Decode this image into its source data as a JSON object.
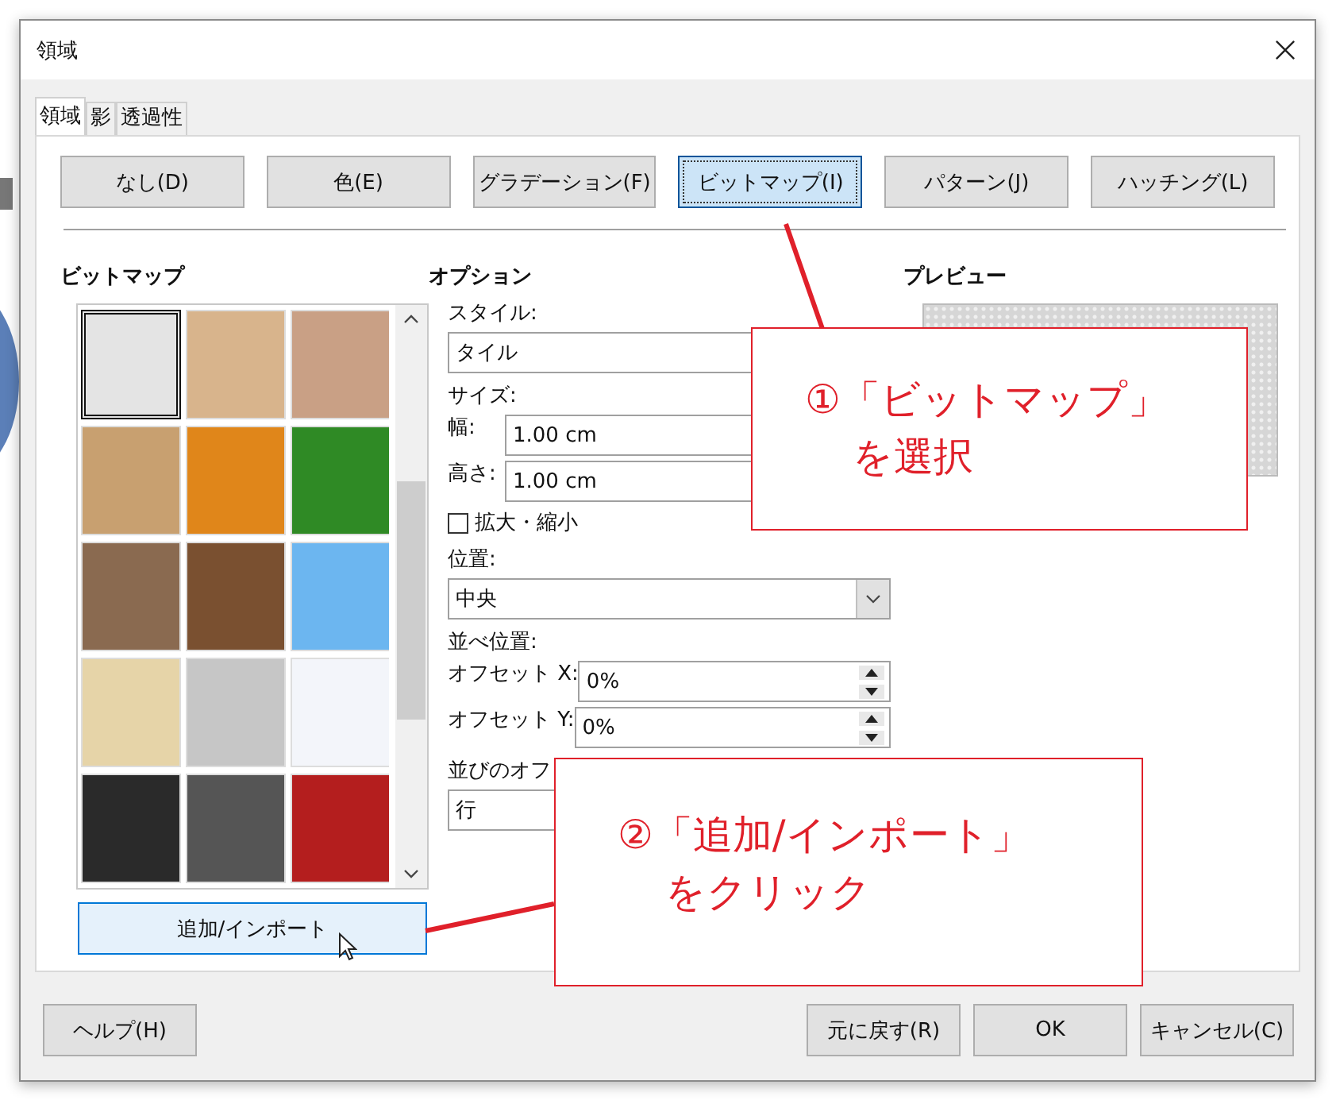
{
  "window": {
    "title": "領域"
  },
  "tabs": [
    {
      "label": "領域",
      "selected": true
    },
    {
      "label": "影",
      "selected": false
    },
    {
      "label": "透過性",
      "selected": false
    }
  ],
  "fill_buttons": [
    {
      "label": "なし(D)",
      "selected": false
    },
    {
      "label": "色(E)",
      "selected": false
    },
    {
      "label": "グラデーション(F)",
      "selected": false
    },
    {
      "label": "ビットマップ(I)",
      "selected": true
    },
    {
      "label": "パターン(J)",
      "selected": false
    },
    {
      "label": "ハッチング(L)",
      "selected": false
    }
  ],
  "bitmap_panel": {
    "heading": "ビットマップ",
    "swatches": [
      {
        "color": "#e4e4e4",
        "selected": true
      },
      {
        "color": "#d8b48c",
        "selected": false
      },
      {
        "color": "#c9a085",
        "selected": false
      },
      {
        "color": "#c8a070",
        "selected": false
      },
      {
        "color": "#e0861a",
        "selected": false
      },
      {
        "color": "#2f8a25",
        "selected": false
      },
      {
        "color": "#8a6a50",
        "selected": false
      },
      {
        "color": "#7a5030",
        "selected": false
      },
      {
        "color": "#6cb6f0",
        "selected": false
      },
      {
        "color": "#e6d4a8",
        "selected": false
      },
      {
        "color": "#c6c6c6",
        "selected": false
      },
      {
        "color": "#f3f5fa",
        "selected": false
      },
      {
        "color": "#2a2a2a",
        "selected": false
      },
      {
        "color": "#555555",
        "selected": false
      },
      {
        "color": "#b41e1e",
        "selected": false
      }
    ],
    "add_button": "追加/インポート"
  },
  "options": {
    "heading": "オプション",
    "style_label": "スタイル:",
    "style_value": "タイル",
    "size_label": "サイズ:",
    "width_label": "幅:",
    "width_value": "1.00 cm",
    "height_label": "高さ:",
    "height_value": "1.00 cm",
    "scale_checkbox": {
      "label": "拡大・縮小",
      "checked": false
    },
    "position_label": "位置:",
    "position_value": "中央",
    "tiling_label": "並べ位置:",
    "offset_x_label": "オフセット X:",
    "offset_x_value": "0%",
    "offset_y_label": "オフセット Y:",
    "offset_y_value": "0%",
    "row_offset_label": "並びのオフ",
    "row_offset_value": "行"
  },
  "preview": {
    "heading": "プレビュー"
  },
  "footer": {
    "left": [
      "ヘルプ(H)"
    ],
    "right": [
      "元に戻す(R)",
      "OK",
      "キャンセル(C)"
    ]
  },
  "annotations": [
    {
      "lines": [
        "①「ビットマップ」",
        "を選択"
      ]
    },
    {
      "lines": [
        "②「追加/インポート」",
        "をクリック"
      ]
    }
  ]
}
